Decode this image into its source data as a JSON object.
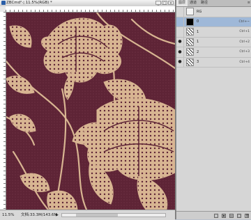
{
  "document": {
    "title": "ZBCmd²·¦ 11.5%(RGB) *",
    "zoom": "11.5%",
    "doc_info": "文档:33.3M/143.6M",
    "window_controls": [
      "_",
      "□",
      "×"
    ]
  },
  "colors": {
    "fabric": "#5e2436",
    "pattern": "#d8b592",
    "selected_layer": "#9fb8d8"
  },
  "layers_panel": {
    "tabs": [
      "图层",
      "通道",
      "路径"
    ],
    "menu_icon": "≡",
    "layers": [
      {
        "name": "RG",
        "shortcut": "",
        "visible": false,
        "thumb": "sketch",
        "selected": false
      },
      {
        "name": "0",
        "shortcut": "Ctrl+~",
        "visible": false,
        "thumb": "black",
        "selected": true
      },
      {
        "name": "1",
        "shortcut": "Ctrl+1",
        "visible": false,
        "thumb": "pattern",
        "selected": false
      },
      {
        "name": "1",
        "shortcut": "Ctrl+2",
        "visible": true,
        "thumb": "pattern",
        "selected": false
      },
      {
        "name": "2",
        "shortcut": "Ctrl+3",
        "visible": true,
        "thumb": "pattern",
        "selected": false
      },
      {
        "name": "3",
        "shortcut": "Ctrl+4",
        "visible": true,
        "thumb": "pattern",
        "selected": false
      }
    ],
    "bottom_icons": [
      "◌",
      "▣",
      "▤",
      "▢",
      "🗑"
    ]
  }
}
